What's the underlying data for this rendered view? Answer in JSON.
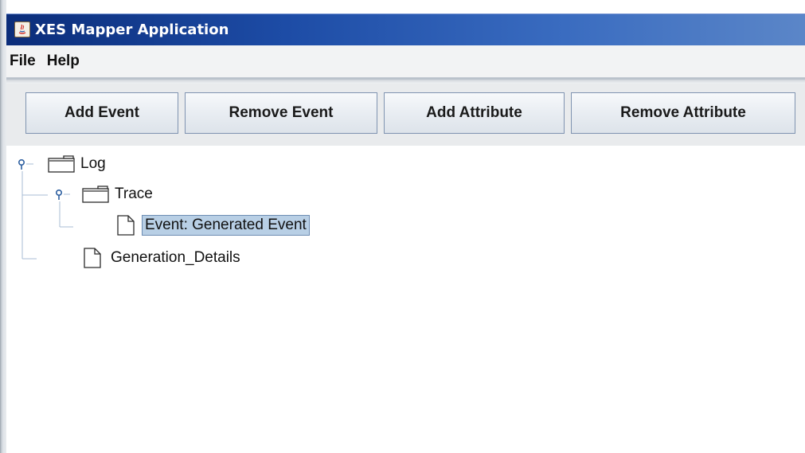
{
  "window": {
    "title": "XES Mapper Application",
    "icon": "java-icon"
  },
  "menu": {
    "items": [
      {
        "label": "File"
      },
      {
        "label": "Help"
      }
    ]
  },
  "toolbar": {
    "add_event_label": "Add Event",
    "remove_event_label": "Remove Event",
    "add_attribute_label": "Add Attribute",
    "remove_attribute_label": "Remove Attribute"
  },
  "tree": {
    "nodes": [
      {
        "label": "Log",
        "icon": "folder-icon",
        "expanded": true
      },
      {
        "label": "Trace",
        "icon": "folder-icon",
        "expanded": true
      },
      {
        "label": "Event: Generated Event",
        "icon": "document-icon",
        "selected": true
      },
      {
        "label": "Generation_Details",
        "icon": "document-icon"
      }
    ]
  },
  "colors": {
    "titlebar_start": "#0b2d7a",
    "titlebar_end": "#5b86c8",
    "selection": "#b8cfe5",
    "tree_line": "#a9bcd6",
    "toggle": "#2d5fa0"
  }
}
